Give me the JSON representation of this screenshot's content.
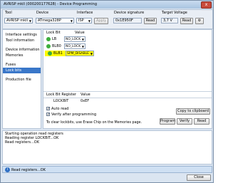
{
  "window": {
    "title": "AVRISP mkII (000200177628) - Device Programming",
    "close_symbol": "x"
  },
  "header": {
    "tool_label": "Tool",
    "tool_value": "AVRISP mkII",
    "device_label": "Device",
    "device_value": "ATmega328P",
    "interface_label": "Interface",
    "interface_value": "ISP",
    "apply_label": "Apply",
    "signature_label": "Device signature",
    "signature_value": "0x1E950F",
    "read_label": "Read",
    "voltage_label": "Target Voltage",
    "voltage_value": "3,7 V",
    "read2_label": "Read",
    "settings_icon": "gear-icon"
  },
  "sidebar": {
    "items": [
      {
        "label": "Interface settings"
      },
      {
        "label": "Tool information"
      },
      {
        "label": "Device information"
      },
      {
        "label": "Memories"
      },
      {
        "label": "Fuses"
      },
      {
        "label": "Lock bits"
      },
      {
        "label": "Production file"
      }
    ],
    "active_index": 5
  },
  "lockbits": {
    "col_name": "Lock Bit",
    "col_value": "Value",
    "rows": [
      {
        "name": "LB",
        "value": "NO_LOCK"
      },
      {
        "name": "BLB0",
        "value": "NO_LOCK"
      },
      {
        "name": "BLB1",
        "value": "SPM_DISABLE"
      }
    ]
  },
  "register": {
    "col_name": "Lock Bit Register",
    "col_value": "Value",
    "name": "LOCKBIT",
    "value": "0xEF"
  },
  "options": {
    "auto_read_label": "Auto read",
    "verify_label": "Verify after programming",
    "copy_label": "Copy to clipboard",
    "program_label": "Program",
    "verify_btn_label": "Verify",
    "read_btn_label": "Read",
    "note": "To clear lockbits, use Erase Chip on the Memories page."
  },
  "log": [
    "Starting operation read registers",
    "Reading register LOCKBIT...OK",
    "Read registers...OK"
  ],
  "status": {
    "text": "Read registers...OK"
  },
  "footer": {
    "close_label": "Close"
  },
  "colors": {
    "highlight": "#fffb00",
    "status_ok": "#3cae3c",
    "selected": "#3a77c9"
  }
}
